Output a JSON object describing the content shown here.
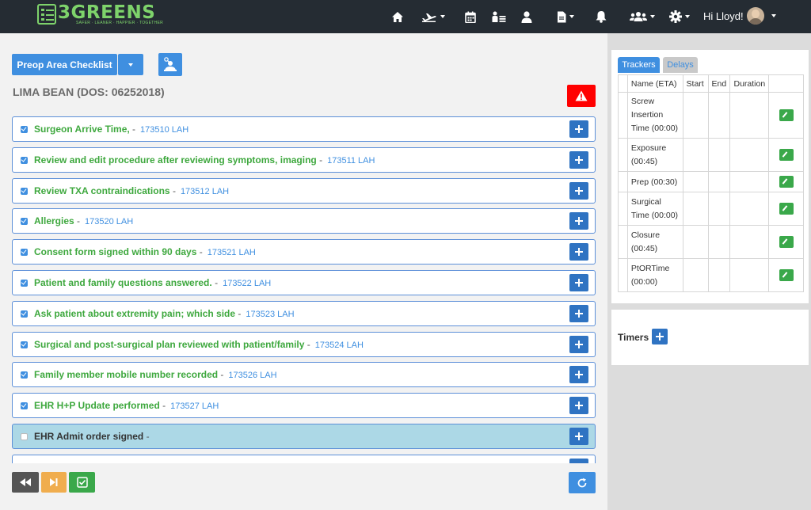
{
  "app": {
    "logo_text": "3GREENS",
    "logo_tagline": "SAFER · LEANER · HAPPIER · TOGETHER"
  },
  "nav": {
    "greeting": "Hi Lloyd!",
    "icons": [
      "home-icon",
      "flight-icon",
      "calendar-icon",
      "patient-list-icon",
      "user-icon",
      "document-icon",
      "bell-icon",
      "group-icon",
      "gear-icon"
    ]
  },
  "checklist": {
    "title_button": "Preop Area Checklist",
    "patient_header": "LIMA BEAN (DOS: 06252018)",
    "items": [
      {
        "title": "Surgeon Arrive Time,",
        "dash": "-",
        "code": "173510 LAH",
        "checked": true
      },
      {
        "title": "Review and edit procedure after reviewing symptoms, imaging",
        "dash": "-",
        "code": "173511 LAH",
        "checked": true
      },
      {
        "title": "Review TXA contraindications",
        "dash": "-",
        "code": "173512 LAH",
        "checked": true
      },
      {
        "title": "Allergies",
        "dash": "-",
        "code": "173520 LAH",
        "checked": true
      },
      {
        "title": "Consent form signed within 90 days",
        "dash": "-",
        "code": "173521 LAH",
        "checked": true
      },
      {
        "title": "Patient and family questions answered.",
        "dash": "-",
        "code": "173522 LAH",
        "checked": true
      },
      {
        "title": "Ask patient about extremity pain; which side",
        "dash": "-",
        "code": "173523 LAH",
        "checked": true
      },
      {
        "title": "Surgical and post-surgical plan reviewed with patient/family",
        "dash": "-",
        "code": "173524 LAH",
        "checked": true
      },
      {
        "title": "Family member mobile number recorded",
        "dash": "-",
        "code": "173526 LAH",
        "checked": true
      },
      {
        "title": "EHR H+P Update performed",
        "dash": "-",
        "code": "173527 LAH",
        "checked": true
      },
      {
        "title": "EHR Admit order signed",
        "dash": "-",
        "code": "",
        "checked": false
      },
      {
        "title": "",
        "dash": "",
        "code": "",
        "checked": false
      }
    ]
  },
  "trackers": {
    "tabs": [
      "Trackers",
      "Delays"
    ],
    "columns": [
      "Name (ETA)",
      "Start",
      "End",
      "Duration"
    ],
    "rows": [
      {
        "name": "Screw Insertion Time (00:00)",
        "start": "",
        "end": "",
        "duration": ""
      },
      {
        "name": "Exposure (00:45)",
        "start": "",
        "end": "",
        "duration": ""
      },
      {
        "name": "Prep (00:30)",
        "start": "",
        "end": "",
        "duration": ""
      },
      {
        "name": "Surgical Time (00:00)",
        "start": "",
        "end": "",
        "duration": ""
      },
      {
        "name": "Closure (00:45)",
        "start": "",
        "end": "",
        "duration": ""
      },
      {
        "name": "PtORTime (00:00)",
        "start": "",
        "end": "",
        "duration": ""
      }
    ]
  },
  "timers": {
    "label": "Timers"
  },
  "colors": {
    "navbar": "#252c33",
    "brand_green": "#7ed36b",
    "primary_blue": "#3f8fe0",
    "plus_blue": "#2f73c2",
    "alert_red": "#ff0000",
    "item_green": "#3ea83e",
    "active_row": "#acd8e6"
  }
}
